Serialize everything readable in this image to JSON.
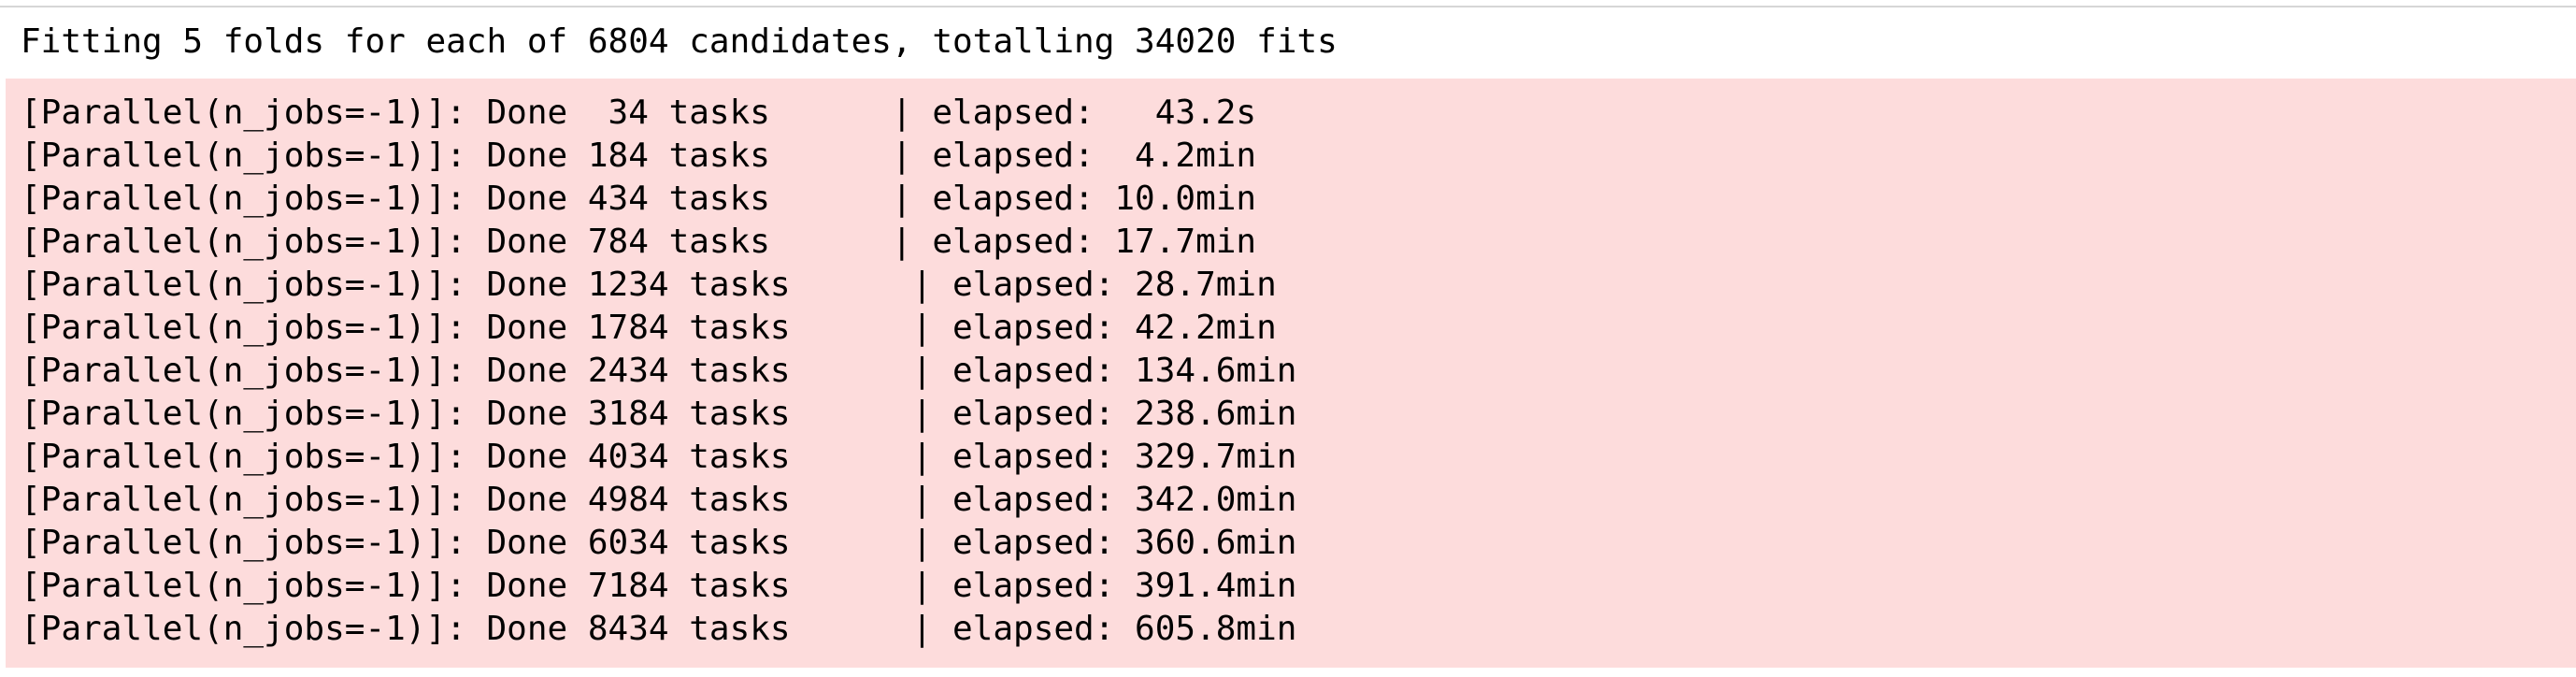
{
  "output": {
    "stdout": "Fitting 5 folds for each of 6804 candidates, totalling 34020 fits",
    "stderr_lines": [
      "[Parallel(n_jobs=-1)]: Done  34 tasks      | elapsed:   43.2s",
      "[Parallel(n_jobs=-1)]: Done 184 tasks      | elapsed:  4.2min",
      "[Parallel(n_jobs=-1)]: Done 434 tasks      | elapsed: 10.0min",
      "[Parallel(n_jobs=-1)]: Done 784 tasks      | elapsed: 17.7min",
      "[Parallel(n_jobs=-1)]: Done 1234 tasks      | elapsed: 28.7min",
      "[Parallel(n_jobs=-1)]: Done 1784 tasks      | elapsed: 42.2min",
      "[Parallel(n_jobs=-1)]: Done 2434 tasks      | elapsed: 134.6min",
      "[Parallel(n_jobs=-1)]: Done 3184 tasks      | elapsed: 238.6min",
      "[Parallel(n_jobs=-1)]: Done 4034 tasks      | elapsed: 329.7min",
      "[Parallel(n_jobs=-1)]: Done 4984 tasks      | elapsed: 342.0min",
      "[Parallel(n_jobs=-1)]: Done 6034 tasks      | elapsed: 360.6min",
      "[Parallel(n_jobs=-1)]: Done 7184 tasks      | elapsed: 391.4min",
      "[Parallel(n_jobs=-1)]: Done 8434 tasks      | elapsed: 605.8min"
    ]
  },
  "colors": {
    "stderr_background": "#fddcdc",
    "text": "#000000"
  }
}
